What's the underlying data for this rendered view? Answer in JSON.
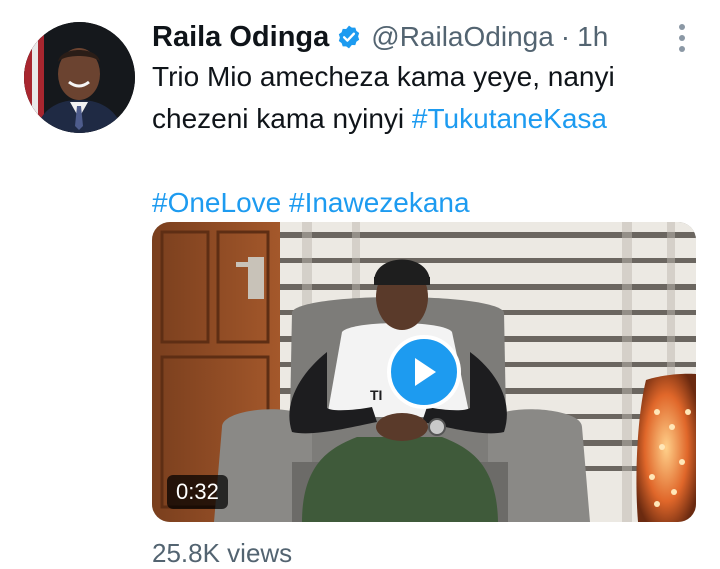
{
  "tweet": {
    "author_name": "Raila Odinga",
    "verified_icon": "verified-badge-icon",
    "handle": "@RailaOdinga",
    "separator": "·",
    "time": "1h",
    "text_line1": "Trio Mio amecheza kama yeye, nanyi",
    "text_line2_plain": "chezeni kama nyinyi ",
    "text_line2_hashtag": "#TukutaneKasa",
    "hashtags_line": [
      "#OneLove",
      "#Inawezekana"
    ],
    "media": {
      "duration": "0:32",
      "play_icon": "play-icon",
      "shirt_text": "TI"
    },
    "views": "25.8K views"
  },
  "colors": {
    "link": "#1d9bf0",
    "text": "#0f1419",
    "secondary": "#536471"
  }
}
